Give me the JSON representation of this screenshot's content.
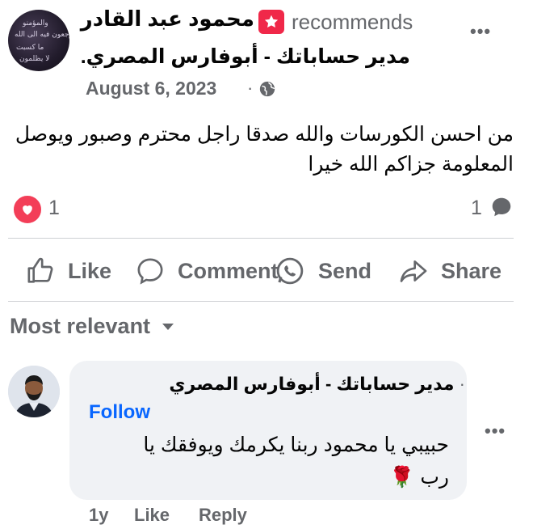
{
  "post": {
    "author": "محمود عبد القادر",
    "action": "recommends",
    "page": "مدير حساباتك - أبوفارس المصري.",
    "date": "August 6, 2023",
    "date_sep": "·",
    "privacy_icon": "globe-icon",
    "body": "من احسن الكورسات والله صدقا راجل محترم وصبور ويوصل المعلومة جزاكم الله خيرا",
    "more": "•••"
  },
  "reactions": {
    "count": "1",
    "comments": "1",
    "icon": "heart-icon",
    "color": "#f33e58"
  },
  "actions": {
    "like": "Like",
    "comment": "Comment",
    "send": "Send",
    "share": "Share"
  },
  "sort": {
    "label": "Most relevant"
  },
  "comment": {
    "author": "مدير حساباتك - أبوفارس المصري",
    "dot": "·",
    "follow": "Follow",
    "text": "حبيبي يا محمود ربنا يكرمك ويوفقك يا رب 🌹",
    "time": "1y",
    "like": "Like",
    "reply": "Reply",
    "more": "•••"
  },
  "colors": {
    "accent": "#0866ff",
    "muted": "#65676b",
    "badge": "#f02849"
  }
}
